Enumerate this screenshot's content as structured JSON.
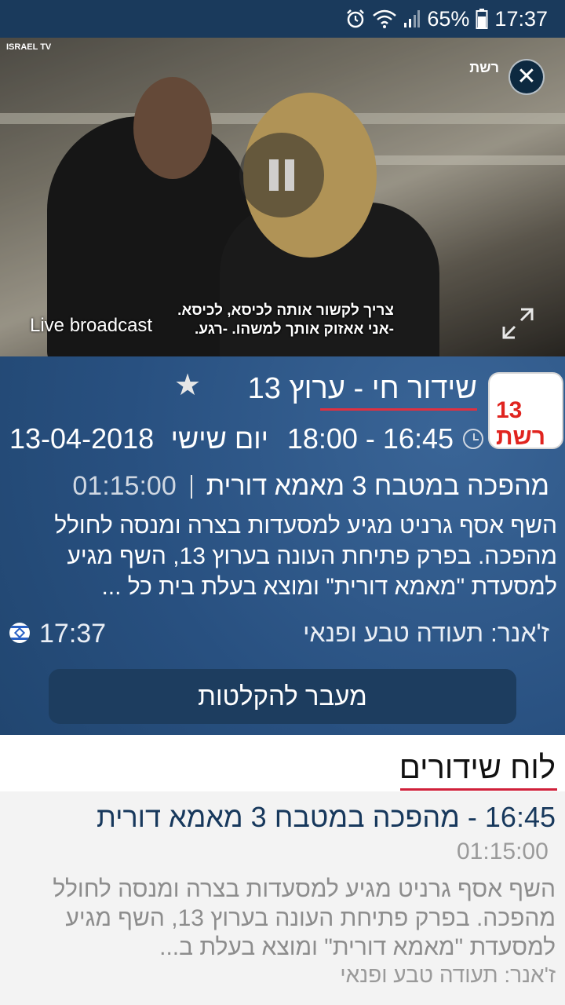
{
  "status_bar": {
    "battery_percent": "65%",
    "time": "17:37",
    "icons": [
      "alarm-icon",
      "wifi-icon",
      "signal-icon",
      "battery-icon"
    ]
  },
  "video": {
    "channel_logo": "ISRAEL TV",
    "watermark": "רשת",
    "subtitle_line1": "צריך לקשור אותה לכיסא, לכיסא.",
    "subtitle_line2": "-אני אאזוק אותך למשהו. -רגע.",
    "live_label": "Live broadcast",
    "icons": [
      "close-icon",
      "pause-icon",
      "expand-icon"
    ]
  },
  "now_playing": {
    "channel_badge": "13 רשת",
    "title": "שידור חי - ערוץ 13",
    "time_range": "18:00 - 16:45",
    "day": "יום שישי",
    "date": "13-04-2018",
    "program": "מהפכה במטבח 3 מאמא דורית",
    "duration": "01:15:00",
    "description": "השף אסף גרניט מגיע למסעדות בצרה ומנסה לחולל מהפכה. בפרק פתיחת העונה בערוץ 13, השף מגיע למסעדת \"מאמא דורית\" ומוצא בעלת בית כל ...",
    "genre": "ז'אנר: תעודה טבע ופנאי",
    "current_time": "17:37",
    "record_button": "מעבר להקלטות",
    "accent_color": "#e03040"
  },
  "schedule": {
    "title": "לוח שידורים",
    "items": [
      {
        "title": "16:45 -  מהפכה במטבח 3 מאמא דורית",
        "duration": "01:15:00",
        "description": "השף אסף גרניט מגיע למסעדות בצרה ומנסה לחולל מהפכה. בפרק פתיחת העונה בערוץ 13, השף מגיע למסעדת \"מאמא דורית\" ומוצא בעלת ב...",
        "genre": "ז'אנר: תעודה טבע ופנאי"
      }
    ]
  }
}
